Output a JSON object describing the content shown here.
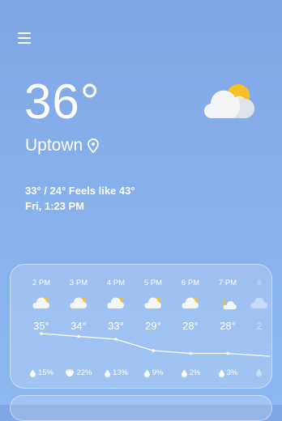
{
  "header": {
    "menu_icon": "hamburger-menu-icon"
  },
  "current": {
    "temperature": "36°",
    "condition_icon": "sun-behind-cloud-icon",
    "location": "Uptown",
    "location_icon": "location-pin-icon",
    "hi_lo_feels": "33° / 24° Feels like 43°",
    "datetime": "Fri, 1:23 PM"
  },
  "hourly": [
    {
      "time": "2 PM",
      "icon": "partly-cloudy-day-icon",
      "temp": "35°",
      "precip": "15%",
      "precip_icon": "raindrop-icon"
    },
    {
      "time": "3 PM",
      "icon": "partly-cloudy-day-icon",
      "temp": "34°",
      "precip": "22%",
      "precip_icon": "rain-cup-icon"
    },
    {
      "time": "4 PM",
      "icon": "partly-cloudy-day-icon",
      "temp": "33°",
      "precip": "13%",
      "precip_icon": "raindrop-icon"
    },
    {
      "time": "5 PM",
      "icon": "partly-cloudy-day-icon",
      "temp": "29°",
      "precip": "9%",
      "precip_icon": "raindrop-icon"
    },
    {
      "time": "6 PM",
      "icon": "partly-cloudy-day-icon",
      "temp": "28°",
      "precip": "2%",
      "precip_icon": "raindrop-icon"
    },
    {
      "time": "7 PM",
      "icon": "moon-icon",
      "temp": "28°",
      "precip": "3%",
      "precip_icon": "raindrop-icon"
    },
    {
      "time": "8",
      "icon": "cloud-icon",
      "temp": "2",
      "precip": "",
      "precip_icon": "raindrop-icon"
    }
  ],
  "trend_temps": [
    35,
    34,
    33,
    29,
    28,
    28,
    27
  ]
}
